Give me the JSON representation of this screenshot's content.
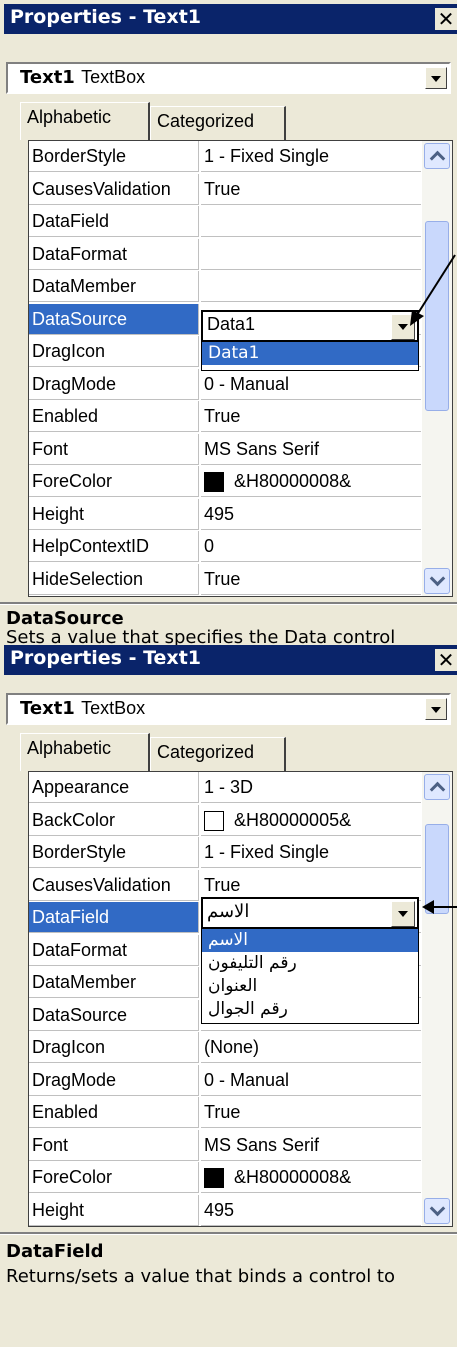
{
  "panel1": {
    "title": "Properties - Text1",
    "object_name": "Text1",
    "object_type": "TextBox",
    "tabs": [
      "Alphabetic",
      "Categorized"
    ],
    "rows": [
      {
        "name": "BorderStyle",
        "value": "1 - Fixed Single"
      },
      {
        "name": "CausesValidation",
        "value": "True"
      },
      {
        "name": "DataField",
        "value": ""
      },
      {
        "name": "DataFormat",
        "value": ""
      },
      {
        "name": "DataMember",
        "value": ""
      },
      {
        "name": "DataSource",
        "value": "Data1"
      },
      {
        "name": "DragIcon",
        "value": ""
      },
      {
        "name": "DragMode",
        "value": "0 - Manual"
      },
      {
        "name": "Enabled",
        "value": "True"
      },
      {
        "name": "Font",
        "value": "MS Sans Serif"
      },
      {
        "name": "ForeColor",
        "value": "&H80000008&"
      },
      {
        "name": "Height",
        "value": "495"
      },
      {
        "name": "HelpContextID",
        "value": "0"
      },
      {
        "name": "HideSelection",
        "value": "True"
      }
    ],
    "selected_row": "DataSource",
    "edit_value": "Data1",
    "dropdown_options": [
      "Data1"
    ],
    "description_title": "DataSource",
    "description_text": "Sets a value that specifies the Data control",
    "forecolor_swatch": "#000000"
  },
  "panel2": {
    "title": "Properties - Text1",
    "object_name": "Text1",
    "object_type": "TextBox",
    "tabs": [
      "Alphabetic",
      "Categorized"
    ],
    "rows": [
      {
        "name": "Appearance",
        "value": "1 - 3D"
      },
      {
        "name": "BackColor",
        "value": "&H80000005&"
      },
      {
        "name": "BorderStyle",
        "value": "1 - Fixed Single"
      },
      {
        "name": "CausesValidation",
        "value": "True"
      },
      {
        "name": "DataField",
        "value": "الاسم"
      },
      {
        "name": "DataFormat",
        "value": ""
      },
      {
        "name": "DataMember",
        "value": ""
      },
      {
        "name": "DataSource",
        "value": ""
      },
      {
        "name": "DragIcon",
        "value": "(None)"
      },
      {
        "name": "DragMode",
        "value": "0 - Manual"
      },
      {
        "name": "Enabled",
        "value": "True"
      },
      {
        "name": "Font",
        "value": "MS Sans Serif"
      },
      {
        "name": "ForeColor",
        "value": "&H80000008&"
      },
      {
        "name": "Height",
        "value": "495"
      }
    ],
    "selected_row": "DataField",
    "edit_value": "الاسم",
    "dropdown_options": [
      "الاسم",
      "رقم التليفون",
      "العنوان",
      "رقم الجوال"
    ],
    "description_title": "DataField",
    "description_text": "Returns/sets a value that binds a control to",
    "backcolor_swatch": "#ffffff",
    "forecolor_swatch": "#000000"
  },
  "colors": {
    "title_bg": "#0a246a",
    "selection": "#316ac5",
    "face": "#ece9d8"
  }
}
